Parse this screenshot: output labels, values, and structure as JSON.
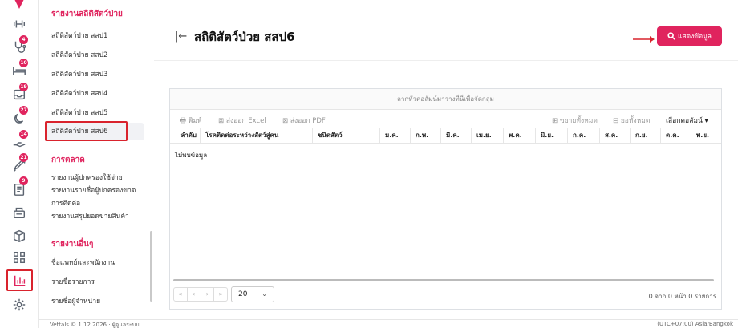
{
  "sidebar": {
    "section_partial": "รายงานสถิติสัตว์ป่วย",
    "items_stats": [
      "สถิติสัตว์ป่วย สสป1",
      "สถิติสัตว์ป่วย สสป2",
      "สถิติสัตว์ป่วย สสป3",
      "สถิติสัตว์ป่วย สสป4",
      "สถิติสัตว์ป่วย สสป5",
      "สถิติสัตว์ป่วย สสป6"
    ],
    "marketing_title": "การตลาด",
    "marketing_items": [
      "รายงานผู้ปกครองใช้จ่าย",
      "รายงานรายชื่อผู้ปกครองขาด",
      "การติดต่อ",
      "รายงานสรุปยอดขายสินค้า"
    ],
    "others_title": "รายงานอื่นๆ",
    "others_items": [
      "ชื่อแพทย์และพนักงาน",
      "รายชื่อรายการ",
      "รายชื่อผู้จำหน่าย"
    ],
    "badges": [
      "4",
      "10",
      "19",
      "27",
      "14",
      "21",
      "9"
    ]
  },
  "page": {
    "back_icon": "collapse-left-icon",
    "title": "สถิติสัตว์ป่วย สสป6",
    "show_button": "แสดงข้อมูล"
  },
  "grid": {
    "group_hint": "ลากหัวคอลัมน์มาวางที่นี่เพื่อจัดกลุ่ม",
    "toolbar": {
      "print": "พิมพ์",
      "excel": "ส่งออก Excel",
      "pdf": "ส่งออก PDF",
      "expand": "ขยายทั้งหมด",
      "collapse": "ยอทั้งหมด",
      "columns": "เลือกคอลัมน์"
    },
    "columns": [
      "ลำดับ",
      "โรคติดต่อระหว่างสัตว์สู่คน",
      "ชนิดสัตว์",
      "ม.ค.",
      "ก.พ.",
      "มี.ค.",
      "เม.ย.",
      "พ.ค.",
      "มิ.ย.",
      "ก.ค.",
      "ส.ค.",
      "ก.ย.",
      "ต.ค.",
      "พ.ย."
    ],
    "empty_text": "ไม่พบข้อมูล",
    "page_size": "20",
    "page_info": "0 จาก 0 หน้า 0 รายการ"
  },
  "footer": {
    "left": "Vettals © 1.12.2026 · ผู้ดูแลระบบ",
    "right": "(UTC+07:00) Asia/Bangkok"
  },
  "colors": {
    "accent": "#e0245e",
    "highlight": "#d9232d"
  }
}
